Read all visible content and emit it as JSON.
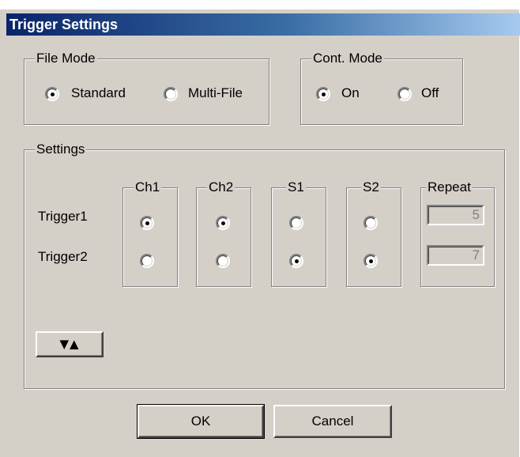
{
  "window": {
    "title": "Trigger Settings"
  },
  "file_mode": {
    "label": "File Mode",
    "options": [
      "Standard",
      "Multi-File"
    ],
    "selected": "Standard"
  },
  "cont_mode": {
    "label": "Cont. Mode",
    "options": [
      "On",
      "Off"
    ],
    "selected": "On"
  },
  "settings": {
    "label": "Settings",
    "columns": [
      "Ch1",
      "Ch2",
      "S1",
      "S2"
    ],
    "repeat_label": "Repeat",
    "rows": [
      {
        "label": "Trigger1",
        "selected": "Ch1",
        "repeat": "5"
      },
      {
        "label": "Trigger2",
        "selected": "S1",
        "repeat": "7"
      }
    ],
    "expand_button": "▼▲"
  },
  "buttons": {
    "ok": "OK",
    "cancel": "Cancel"
  },
  "colors": {
    "title_bar_start": "#0a246a",
    "title_bar_end": "#a6caf0",
    "window_face": "#d4d0c8"
  }
}
